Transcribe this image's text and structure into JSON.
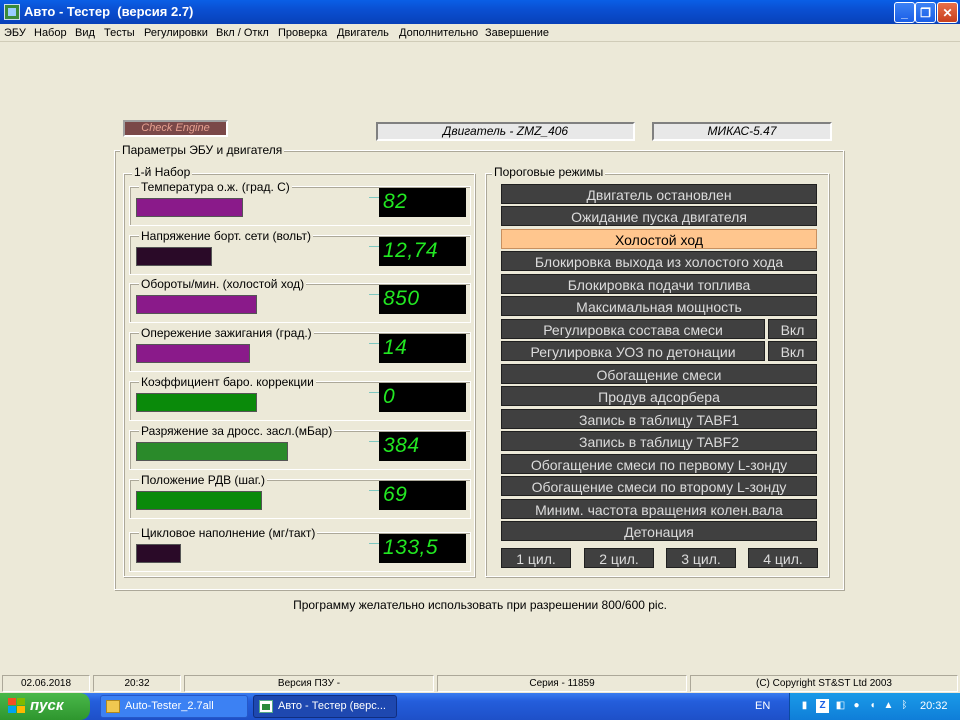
{
  "window": {
    "title": "Авто - Тестер  (версия 2.7)"
  },
  "menu": [
    "ЭБУ",
    "Набор",
    "Вид",
    "Тесты",
    "Регулировки",
    "Вкл / Откл",
    "Проверка",
    "Двигатель",
    "Дополнительно",
    "Завершение"
  ],
  "header": {
    "check_engine": "Check Engine",
    "engine": "Двигатель - ZMZ_406",
    "ecu": "МИКАС-5.47"
  },
  "params_group": {
    "title": "Параметры ЭБУ и двигателя",
    "set_title": "1-й  Набор"
  },
  "params": [
    {
      "label": "Температура  о.ж. (град. С)",
      "value": "82",
      "level": 0.45,
      "color": "#8a1a8a"
    },
    {
      "label": "Напряжение борт. сети (вольт)",
      "value": "12,74",
      "level": 0.32,
      "color": "#2a0a28"
    },
    {
      "label": "Обороты/мин. (холостой ход)",
      "value": "850",
      "level": 0.51,
      "color": "#8a1a8a"
    },
    {
      "label": "Опережение зажигания (град.)",
      "value": "14",
      "level": 0.48,
      "color": "#8a1a8a"
    },
    {
      "label": "Коэффициент баро. коррекции",
      "value": "0",
      "level": 0.51,
      "color": "#0a8a0a"
    },
    {
      "label": "Разряжение за дросс. засл.(мБар)",
      "value": "384",
      "level": 0.64,
      "color": "#2a8a2a"
    },
    {
      "label": "Положение РДВ (шаг.)",
      "value": "69",
      "level": 0.53,
      "color": "#0a8a0a"
    },
    {
      "label": "Цикловое наполнение (мг/такт)",
      "value": "133,5",
      "level": 0.19,
      "color": "#2a0a28"
    }
  ],
  "modes_group": {
    "title": "Пороговые режимы"
  },
  "modes": [
    {
      "label": "Двигатель остановлен",
      "active": false
    },
    {
      "label": "Ожидание пуска двигателя",
      "active": false
    },
    {
      "label": "Холостой ход",
      "active": true
    },
    {
      "label": "Блокировка выхода из холостого хода",
      "active": false
    },
    {
      "label": "Блокировка подачи топлива",
      "active": false
    },
    {
      "label": "Максимальная мощность",
      "active": false
    },
    {
      "label": "Регулировка состава смеси",
      "active": false,
      "toggle": "Вкл"
    },
    {
      "label": "Регулировка УОЗ по детонации",
      "active": false,
      "toggle": "Вкл"
    },
    {
      "label": "Обогащение смеси",
      "active": false
    },
    {
      "label": "Продув адсорбера",
      "active": false
    },
    {
      "label": "Запись в таблицу TABF1",
      "active": false
    },
    {
      "label": "Запись в таблицу TABF2",
      "active": false
    },
    {
      "label": "Обогащение смеси по первому L-зонду",
      "active": false
    },
    {
      "label": "Обогащение смеси по второму L-зонду",
      "active": false
    },
    {
      "label": "Миним. частота вращения колен.вала",
      "active": false
    },
    {
      "label": "Детонация",
      "active": false
    }
  ],
  "cylinders": [
    "1 цил.",
    "2 цил.",
    "3 цил.",
    "4 цил."
  ],
  "note": "Программу желательно использовать при разрешении 800/600 pic.",
  "status": {
    "date": "02.06.2018",
    "time": "20:32",
    "rom": "Версия ПЗУ -",
    "serial": "Серия - 11859",
    "copyright": "(C) Copyright   ST&ST  Ltd 2003"
  },
  "taskbar": {
    "start": "пуск",
    "tasks": [
      "Auto-Tester_2.7all",
      "Авто - Тестер  (верс..."
    ],
    "lang": "EN",
    "clock": "20:32"
  },
  "colors": {
    "active_mode": "#ffc68e",
    "inactive_mode": "#404040",
    "digit": "#22e822"
  }
}
